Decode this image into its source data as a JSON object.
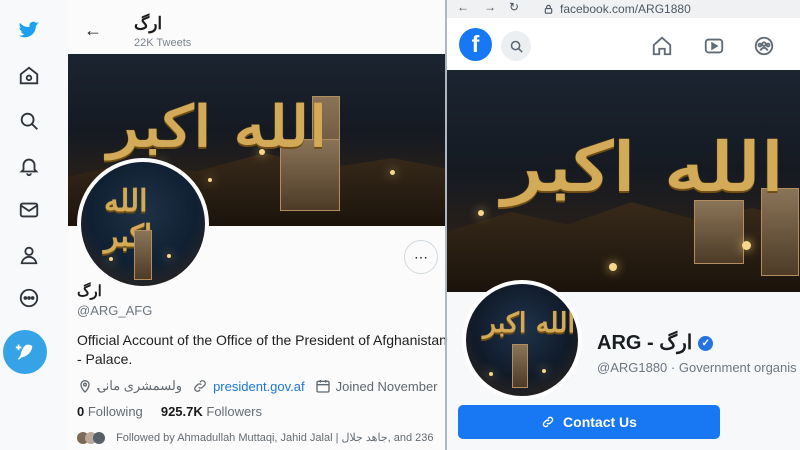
{
  "twitter": {
    "header": {
      "title": "ارگ",
      "tweet_count": "22K Tweets"
    },
    "banner_calligraphy": "الله اکبر",
    "profile": {
      "name": "ارگ",
      "handle": "@ARG_AFG",
      "bio": "Official Account of the Office of the President of Afghanistan - Palace.",
      "location": "ولسمشری مانۍ",
      "website": "president.gov.af",
      "joined": "Joined November"
    },
    "stats": {
      "following_count": "0",
      "following_label": "Following",
      "followers_count": "925.7K",
      "followers_label": "Followers"
    },
    "followed_by": "Followed by Ahmadullah Muttaqi, Jahid Jalal | جاهد جلال, and 236"
  },
  "facebook": {
    "browser": {
      "url": "facebook.com/ARG1880"
    },
    "logo": "f",
    "banner_calligraphy": "الله اکبر",
    "profile": {
      "name": "ARG - ارگ",
      "handle": "@ARG1880",
      "category": "· Government organis"
    },
    "contact_button": "Contact Us"
  }
}
